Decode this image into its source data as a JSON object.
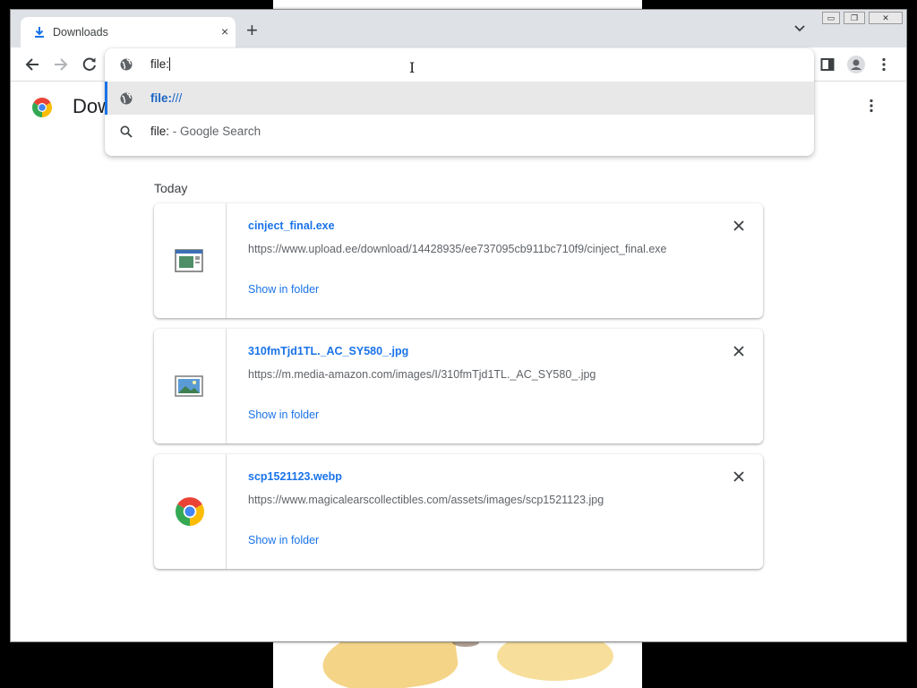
{
  "tab": {
    "title": "Downloads",
    "close_glyph": "×",
    "icon": "download-icon"
  },
  "tabstrip": {
    "new_tab_glyph": "+",
    "tab_search_icon": "chevron-down-icon"
  },
  "window_controls": {
    "minimize": "▭",
    "restore": "❐",
    "close": "✕"
  },
  "omnibox": {
    "input_value": "file:",
    "suggestions": [
      {
        "url_bold": "file:",
        "url_rest": "///",
        "icon": "globe-icon",
        "selected": true
      },
      {
        "query": "file:",
        "separator": " - ",
        "provider": "Google Search",
        "icon": "search-icon"
      }
    ]
  },
  "page": {
    "title": "Downloads",
    "title_visible": "Dow",
    "section": "Today",
    "items": [
      {
        "name": "cinject_final.exe",
        "url": "https://www.upload.ee/download/14428935/ee737095cb911bc710f9/cinject_final.exe",
        "action": "Show in folder",
        "icon": "executable-file-icon"
      },
      {
        "name": "310fmTjd1TL._AC_SY580_.jpg",
        "url": "https://m.media-amazon.com/images/I/310fmTjd1TL._AC_SY580_.jpg",
        "action": "Show in folder",
        "icon": "image-file-icon"
      },
      {
        "name": "scp1521123.webp",
        "url": "https://www.magicalearscollectibles.com/assets/images/scp1521123.jpg",
        "action": "Show in folder",
        "icon": "chrome-icon"
      }
    ]
  },
  "colors": {
    "accent": "#1a73e8",
    "tabstrip": "#dee1e6",
    "selected_row": "#e8e8e8"
  }
}
